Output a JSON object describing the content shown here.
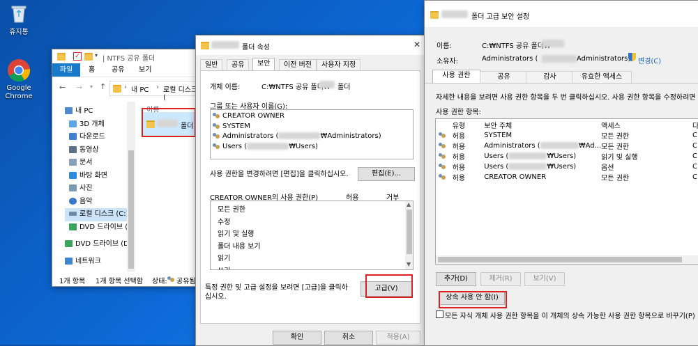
{
  "desktop": {
    "recycle_bin": "휴지통",
    "chrome": "Google Chrome"
  },
  "explorer": {
    "title": "| NTFS 공유 폴더",
    "ribbon_tabs": [
      "파일",
      "홈",
      "공유",
      "보기"
    ],
    "path_parts": [
      "내 PC",
      "로컬 디스크 ("
    ],
    "nav": [
      {
        "label": "내 PC",
        "icon": "pc-icon"
      },
      {
        "label": "3D 개체",
        "icon": "3d-icon"
      },
      {
        "label": "다운로드",
        "icon": "download-icon"
      },
      {
        "label": "동영상",
        "icon": "video-icon"
      },
      {
        "label": "문서",
        "icon": "document-icon"
      },
      {
        "label": "바탕 화면",
        "icon": "desktop-icon"
      },
      {
        "label": "사진",
        "icon": "picture-icon"
      },
      {
        "label": "음악",
        "icon": "music-icon"
      },
      {
        "label": "로컬 디스크 (C:)",
        "icon": "disk-icon"
      },
      {
        "label": "DVD 드라이브 (",
        "icon": "dvd-icon"
      },
      {
        "label": "DVD 드라이브 (D",
        "icon": "dvd-icon"
      },
      {
        "label": "네트워크",
        "icon": "network-icon"
      }
    ],
    "col_header": "이름",
    "folder_suffix": "폴더",
    "status_count": "1개 항목",
    "status_selected": "1개 항목 선택함",
    "status_state": "상태:",
    "status_shared": "공유됨"
  },
  "props": {
    "title_suffix": "폴더 속성",
    "tabs": [
      "일반",
      "공유",
      "보안",
      "이전 버전",
      "사용자 지정"
    ],
    "active_tab": "보안",
    "object_label": "개체 이름:",
    "object_value_prefix": "C:₩NTFS 공유 폴더₩",
    "object_value_suffix": "폴더",
    "groups_label": "그룹 또는 사용자 이름(G):",
    "groups": [
      {
        "name": "CREATOR OWNER",
        "suffix": ""
      },
      {
        "name": "SYSTEM",
        "suffix": ""
      },
      {
        "name": "Administrators (",
        "suffix": "₩Administrators)"
      },
      {
        "name": "Users (",
        "suffix": "₩Users)"
      }
    ],
    "edit_hint": "사용 권한을 변경하려면 [편집]을 클릭하십시오.",
    "edit_button": "편집(E)...",
    "perm_label": "CREATOR OWNER의 사용 권한(P)",
    "allow_col": "허용",
    "deny_col": "거부",
    "perms": [
      "모든 권한",
      "수정",
      "읽기 및 실행",
      "폴더 내용 보기",
      "읽기",
      "쓰기"
    ],
    "adv_hint_1": "특정 권한 및 고급 설정을 보려면 [고급]을 클릭하",
    "adv_hint_2": "십시오.",
    "advanced_button": "고급(V)",
    "ok_button": "확인",
    "cancel_button": "취소",
    "apply_button": "적용(A)"
  },
  "adv": {
    "title_suffix": "폴더 고급 보안 설정",
    "name_label": "이름:",
    "name_value": "C:₩NTFS 공유 폴더₩",
    "owner_label": "소유자:",
    "owner_value_prefix": "Administrators (",
    "owner_value_suffix": "Administrators)",
    "change_link": "변경(C)",
    "tabs": [
      "사용 권한",
      "공유",
      "감사",
      "유효한 액세스"
    ],
    "active_tab": "사용 권한",
    "info": "자세한 내용을 보려면 사용 권한 항목을 두 번 클릭하십시오. 사용 권한 항목을 수정하려면 항",
    "entries_label": "사용 권한 항목:",
    "headers": [
      "유형",
      "보안 주체",
      "액세스",
      "다"
    ],
    "rows": [
      {
        "type": "허용",
        "principal": "SYSTEM",
        "principal_suffix": "",
        "access": "모든 권한",
        "inherit": "C"
      },
      {
        "type": "허용",
        "principal": "Administrators (",
        "principal_suffix": "₩Ad...",
        "access": "모든 권한",
        "inherit": "C"
      },
      {
        "type": "허용",
        "principal": "Users (",
        "principal_suffix": "₩Users)",
        "access": "읽기 및 실행",
        "inherit": "C"
      },
      {
        "type": "허용",
        "principal": "Users (",
        "principal_suffix": "₩Users)",
        "access": "옵션",
        "inherit": "C"
      },
      {
        "type": "허용",
        "principal": "CREATOR OWNER",
        "principal_suffix": "",
        "access": "모든 권한",
        "inherit": "C"
      }
    ],
    "add_button": "추가(D)",
    "remove_button": "제거(R)",
    "view_button": "보기(V)",
    "disable_inheritance_button": "상속 사용 안 함(I)",
    "replace_checkbox": "모든 자식 개체 사용 권한 항목을 이 개체의 상속 가능한 사용 권한 항목으로 바꾸기(P)"
  }
}
